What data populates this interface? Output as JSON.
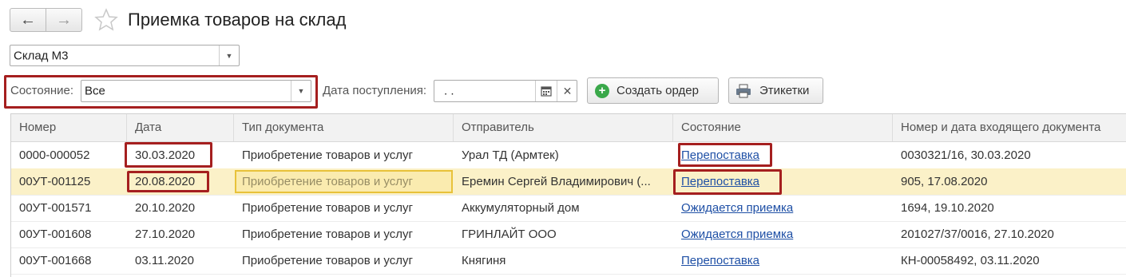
{
  "header": {
    "back_icon": "arrow-left-icon",
    "forward_icon": "arrow-right-icon",
    "favorite_icon": "star-icon",
    "title": "Приемка товаров на склад"
  },
  "filters": {
    "warehouse": "Склад М3",
    "state_label": "Состояние:",
    "state_value": "Все",
    "date_label": "Дата поступления:",
    "date_value": ". .",
    "create_order_label": "Создать ордер",
    "labels_button": "Этикетки"
  },
  "table": {
    "columns": [
      "Номер",
      "Дата",
      "Тип документа",
      "Отправитель",
      "Состояние",
      "Номер и дата входящего документа"
    ],
    "rows": [
      {
        "number": "0000-000052",
        "date": "30.03.2020",
        "doc_type": "Приобретение товаров и услуг",
        "sender": "Урал ТД (Армтек)",
        "state": "Перепоставка",
        "incoming": "0030321/16, 30.03.2020"
      },
      {
        "number": "00УТ-001125",
        "date": "20.08.2020",
        "doc_type": "Приобретение товаров и услуг",
        "sender": "Еремин Сергей Владимирович (...",
        "state": "Перепоставка",
        "incoming": "905, 17.08.2020"
      },
      {
        "number": "00УТ-001571",
        "date": "20.10.2020",
        "doc_type": "Приобретение товаров и услуг",
        "sender": "Аккумуляторный дом",
        "state": "Ожидается приемка",
        "incoming": "1694, 19.10.2020"
      },
      {
        "number": "00УТ-001608",
        "date": "27.10.2020",
        "doc_type": "Приобретение товаров и услуг",
        "sender": "ГРИНЛАЙТ ООО",
        "state": "Ожидается приемка",
        "incoming": "201027/37/0016, 27.10.2020"
      },
      {
        "number": "00УТ-001668",
        "date": "03.11.2020",
        "doc_type": "Приобретение товаров и услуг",
        "sender": "Княгиня",
        "state": "Перепоставка",
        "incoming": "КН-00058492, 03.11.2020"
      }
    ]
  },
  "colors": {
    "highlight_border": "#a51f1f",
    "selected_row": "#fbf1c8",
    "link": "#1e4fa5"
  }
}
